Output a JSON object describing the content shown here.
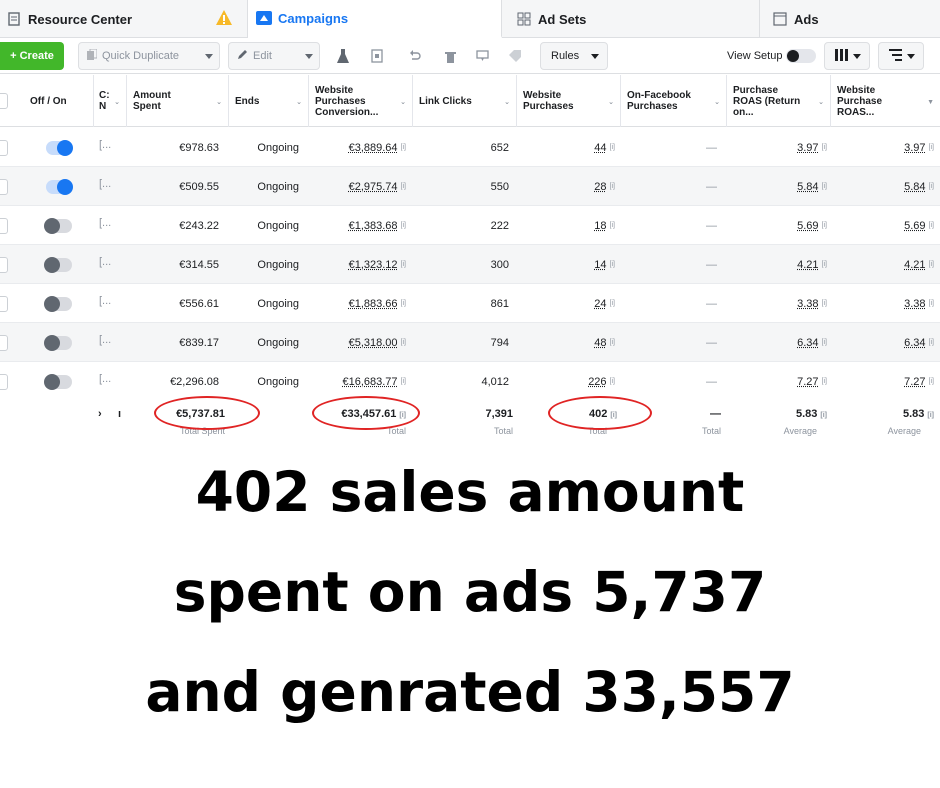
{
  "tabs": {
    "resource_center": "Resource Center",
    "campaigns": "Campaigns",
    "ad_sets": "Ad Sets",
    "ads": "Ads"
  },
  "toolbar": {
    "create": "+ Create",
    "quick_duplicate": "Quick Duplicate",
    "edit": "Edit",
    "rules": "Rules",
    "view_setup": "View Setup",
    "columns_icon": "columns-icon",
    "breakdown_icon": "breakdown-icon"
  },
  "table": {
    "headers": {
      "off_on": "Off / On",
      "name": "C: N",
      "amount_spent": "Amount Spent",
      "ends": "Ends",
      "website_purchases_conversion": "Website Purchases Conversion...",
      "link_clicks": "Link Clicks",
      "website_purchases": "Website Purchases",
      "on_facebook_purchases": "On-Facebook Purchases",
      "purchase_roas": "Purchase ROAS (Return on...",
      "website_purchase_roas": "Website Purchase ROAS..."
    },
    "rows": [
      {
        "on": true,
        "name": "[...",
        "amount": "€978.63",
        "ends": "Ongoing",
        "conv": "€3,889.64",
        "clicks": "652",
        "purchases": "44",
        "fb": "—",
        "roas": "3.97",
        "wroas": "3.97"
      },
      {
        "on": true,
        "name": "[...",
        "amount": "€509.55",
        "ends": "Ongoing",
        "conv": "€2,975.74",
        "clicks": "550",
        "purchases": "28",
        "fb": "—",
        "roas": "5.84",
        "wroas": "5.84"
      },
      {
        "on": false,
        "name": "[...",
        "amount": "€243.22",
        "ends": "Ongoing",
        "conv": "€1,383.68",
        "clicks": "222",
        "purchases": "18",
        "fb": "—",
        "roas": "5.69",
        "wroas": "5.69"
      },
      {
        "on": false,
        "name": "[...",
        "amount": "€314.55",
        "ends": "Ongoing",
        "conv": "€1,323.12",
        "clicks": "300",
        "purchases": "14",
        "fb": "—",
        "roas": "4.21",
        "wroas": "4.21"
      },
      {
        "on": false,
        "name": "[...",
        "amount": "€556.61",
        "ends": "Ongoing",
        "conv": "€1,883.66",
        "clicks": "861",
        "purchases": "24",
        "fb": "—",
        "roas": "3.38",
        "wroas": "3.38"
      },
      {
        "on": false,
        "name": "[...",
        "amount": "€839.17",
        "ends": "Ongoing",
        "conv": "€5,318.00",
        "clicks": "794",
        "purchases": "48",
        "fb": "—",
        "roas": "6.34",
        "wroas": "6.34"
      },
      {
        "on": false,
        "name": "[...",
        "amount": "€2,296.08",
        "ends": "Ongoing",
        "conv": "€16,683.77",
        "clicks": "4,012",
        "purchases": "226",
        "fb": "—",
        "roas": "7.27",
        "wroas": "7.27"
      }
    ],
    "totals": {
      "amount": "€5,737.81",
      "amount_label": "Total Spent",
      "conv": "€33,457.61",
      "conv_label": "Total",
      "clicks": "7,391",
      "clicks_label": "Total",
      "purchases": "402",
      "purchases_label": "Total",
      "fb": "—",
      "fb_label": "Total",
      "roas": "5.83",
      "roas_label": "Average",
      "wroas": "5.83",
      "wroas_label": "Average"
    }
  },
  "caption": {
    "line1": "402 sales amount",
    "line2": "spent on ads 5,737",
    "line3": "and genrated 33,557"
  },
  "colors": {
    "accent": "#1877f2",
    "create_green": "#42b72a",
    "annotation_red": "#e02424"
  }
}
